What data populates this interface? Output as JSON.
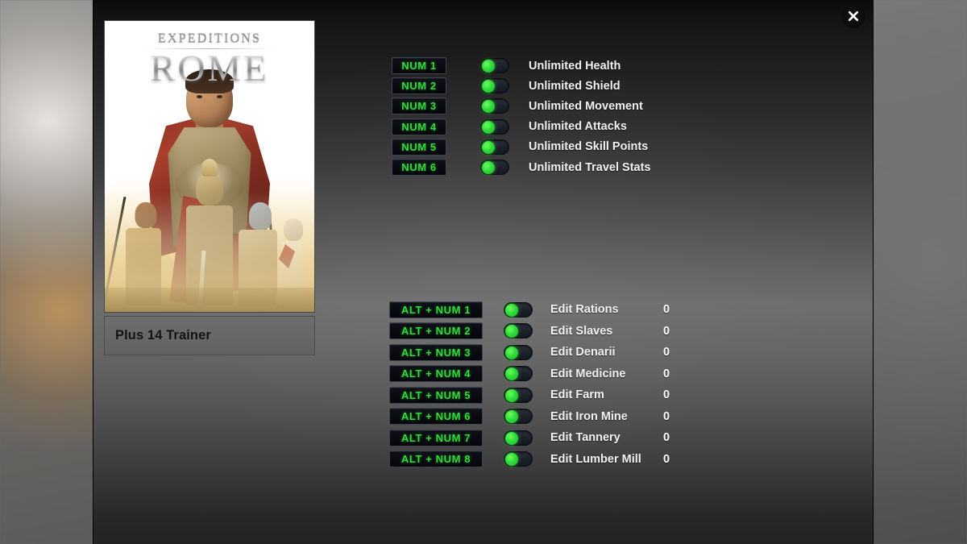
{
  "window": {
    "close_icon": "close-x-icon"
  },
  "cover": {
    "logo_top": "EXPEDITIONS",
    "logo_main": "ROME",
    "title": "Plus 14 Trainer"
  },
  "cheats_main": [
    {
      "hotkey": "NUM 1",
      "label": "Unlimited Health",
      "toggle": "on"
    },
    {
      "hotkey": "NUM 2",
      "label": "Unlimited Shield",
      "toggle": "on"
    },
    {
      "hotkey": "NUM 3",
      "label": "Unlimited Movement",
      "toggle": "on"
    },
    {
      "hotkey": "NUM 4",
      "label": "Unlimited Attacks",
      "toggle": "on"
    },
    {
      "hotkey": "NUM 5",
      "label": "Unlimited Skill Points",
      "toggle": "on"
    },
    {
      "hotkey": "NUM 6",
      "label": "Unlimited Travel Stats",
      "toggle": "on"
    }
  ],
  "cheats_edit": [
    {
      "hotkey": "ALT + NUM 1",
      "label": "Edit Rations",
      "value": "0",
      "toggle": "on"
    },
    {
      "hotkey": "ALT + NUM 2",
      "label": "Edit Slaves",
      "value": "0",
      "toggle": "on"
    },
    {
      "hotkey": "ALT + NUM 3",
      "label": "Edit Denarii",
      "value": "0",
      "toggle": "on"
    },
    {
      "hotkey": "ALT + NUM 4",
      "label": "Edit Medicine",
      "value": "0",
      "toggle": "on"
    },
    {
      "hotkey": "ALT + NUM 5",
      "label": "Edit Farm",
      "value": "0",
      "toggle": "on"
    },
    {
      "hotkey": "ALT + NUM 6",
      "label": "Edit Iron Mine",
      "value": "0",
      "toggle": "on"
    },
    {
      "hotkey": "ALT + NUM 7",
      "label": "Edit Tannery",
      "value": "0",
      "toggle": "on"
    },
    {
      "hotkey": "ALT + NUM 8",
      "label": "Edit Lumber Mill",
      "value": "0",
      "toggle": "on"
    }
  ],
  "colors": {
    "hotkey_text": "#2fdc3a",
    "toggle_on": "#2fdc3a",
    "label_text": "#f2f2f2",
    "title_text": "#141414"
  }
}
